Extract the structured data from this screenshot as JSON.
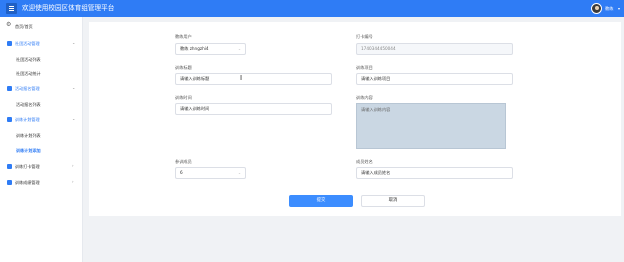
{
  "header": {
    "title": "欢迎使用校园区体育组管理平台",
    "username": "教练",
    "menu_icon": "menu-icon",
    "avatar_icon": "avatar-icon"
  },
  "sidebar": {
    "items": [
      {
        "label": "首页/首页",
        "icon": "gear-icon"
      },
      {
        "label": "社团活动管理",
        "icon": "folder-icon"
      },
      {
        "label": "社团活动列表"
      },
      {
        "label": "社团活动统计"
      },
      {
        "label": "活动报名管理",
        "icon": "folder-icon"
      },
      {
        "label": "活动报名列表"
      },
      {
        "label": "训练计划管理",
        "icon": "folder-icon"
      },
      {
        "label": "训练计划列表"
      },
      {
        "label": "训练计划添加"
      },
      {
        "label": "训练打卡管理",
        "icon": "folder-icon"
      },
      {
        "label": "训练成绩管理",
        "icon": "folder-icon"
      }
    ]
  },
  "form": {
    "coach_label": "教练用户",
    "coach_value": "教练 zhngzhi4",
    "checkin_no_label": "打卡编号",
    "checkin_no_value": "1740344450044",
    "title_label": "训练标题",
    "title_placeholder": "请输入训练标题",
    "project_label": "训练项目",
    "project_placeholder": "请输入训练项目",
    "time_label": "训练时间",
    "time_placeholder": "请输入训练时间",
    "content_label": "训练内容",
    "content_placeholder": "请输入训练内容",
    "member_label": "参训成员",
    "member_value": "6",
    "member_name_label": "成员姓名",
    "member_name_placeholder": "请输入成员姓名",
    "submit_label": "提交",
    "cancel_label": "取消"
  }
}
